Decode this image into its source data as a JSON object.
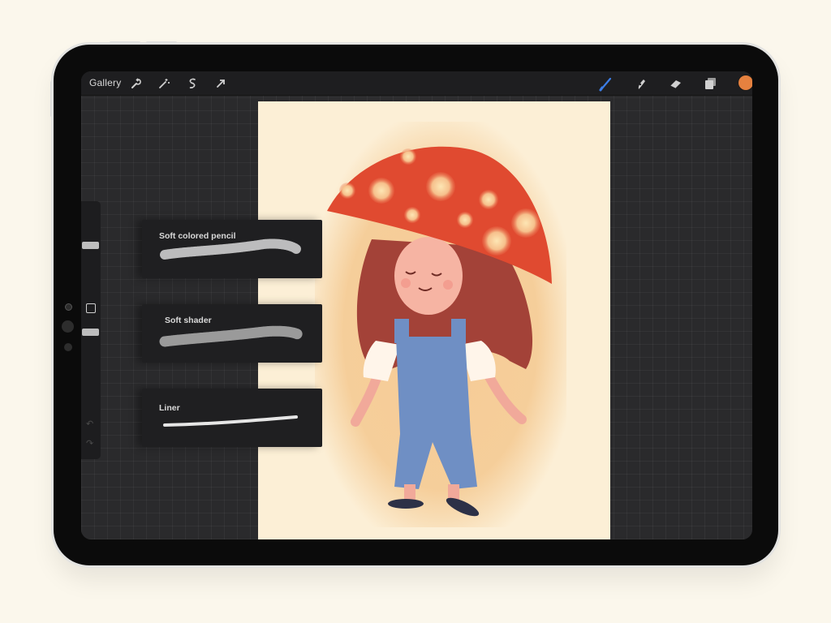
{
  "toolbar": {
    "gallery_label": "Gallery",
    "left_icons": [
      "wrench-icon",
      "magic-wand-icon",
      "selection-s-icon",
      "transform-arrow-icon"
    ],
    "right_icons": [
      "brush-icon",
      "smudge-icon",
      "eraser-icon",
      "layers-icon"
    ],
    "active_tool": "brush",
    "current_color": "#e5813f"
  },
  "sidebar": {
    "brush_size": 0.85,
    "opacity": 0.45,
    "undo_icon": "undo-arrow-icon",
    "redo_icon": "redo-arrow-icon"
  },
  "brushes": [
    {
      "name": "Soft colored pencil"
    },
    {
      "name": "Soft shader"
    },
    {
      "name": "Liner"
    }
  ],
  "colors": {
    "canvas_bg": "#fcefd6",
    "screen_bg": "#2a2a2c",
    "mushroom_cap": "#e04a30",
    "overalls": "#6f8fc4",
    "hair": "#9e3a33",
    "accent_blue": "#3c7de6"
  }
}
